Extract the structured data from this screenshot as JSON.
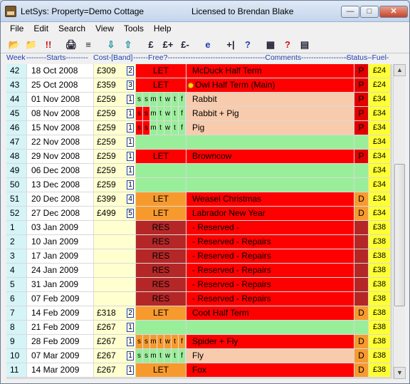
{
  "window": {
    "title": "LetSys: Property=Demo Cottage",
    "license": "Licensed to Brendan Blake",
    "minimize": "—",
    "maximize": "□",
    "close": "✕"
  },
  "menu": [
    "File",
    "Edit",
    "Search",
    "View",
    "Tools",
    "Help"
  ],
  "toolbar": [
    {
      "icon": "folder-open-icon",
      "glyph": "📂"
    },
    {
      "icon": "folder-icon",
      "glyph": "📁"
    },
    {
      "icon": "alert-icon",
      "glyph": "!!"
    },
    {
      "icon": "print-icon",
      "glyph": "🖨"
    },
    {
      "icon": "print-preview-icon",
      "glyph": "≡"
    },
    {
      "icon": "arrow-down-icon",
      "glyph": "⇩"
    },
    {
      "icon": "arrow-up-icon",
      "glyph": "⇧"
    },
    {
      "icon": "pound-icon",
      "glyph": "£"
    },
    {
      "icon": "pound-plus-icon",
      "glyph": "£+"
    },
    {
      "icon": "pound-minus-icon",
      "glyph": "£-"
    },
    {
      "icon": "internet-explorer-icon",
      "glyph": "e"
    },
    {
      "icon": "split-icon",
      "glyph": "+|"
    },
    {
      "icon": "help-icon",
      "glyph": "?"
    },
    {
      "icon": "calculator-icon",
      "glyph": "▦"
    },
    {
      "icon": "help-red-icon",
      "glyph": "?"
    },
    {
      "icon": "notes-icon",
      "glyph": "▤"
    }
  ],
  "header": {
    "week": "Week",
    "starts": "--------Starts---------",
    "cost": "Cost-[Band]",
    "free": "------Free?-------",
    "comments": "---------------------------------Comments---------------------------------",
    "status": "-Status-",
    "fuel": "-Fuel-"
  },
  "colors": {
    "let_red": "#ff0000",
    "let_orange": "#f79a2e",
    "res": "#b52727",
    "comment_red": "#ff0000",
    "comment_salmon": "#f8cbad",
    "free_green": "#99ee99",
    "fuel_yellow": "#ffff33",
    "status_red": "#e00000",
    "status_orange": "#f79a2e"
  },
  "rows": [
    {
      "week": "42",
      "start": "18 Oct 2008",
      "cost": "£309",
      "band": "2",
      "free": "LET",
      "free_type": "let_red",
      "comment": "McDuck  Half Term",
      "comment_type": "red",
      "status": "P",
      "fuel": "£24"
    },
    {
      "week": "43",
      "start": "25 Oct 2008",
      "cost": "£359",
      "band": "3",
      "free": "LET",
      "free_type": "let_red",
      "comment": "Owl  Half Term (Main)",
      "comment_type": "red",
      "dot": true,
      "status": "P",
      "fuel": "£24"
    },
    {
      "week": "44",
      "start": "01 Nov 2008",
      "cost": "£259",
      "band": "1",
      "free": "",
      "free_type": "days",
      "days": [
        "s",
        "s",
        "m",
        "t",
        "w",
        "t",
        "f"
      ],
      "days_let": 0,
      "comment": "Rabbit",
      "comment_type": "salmon",
      "status": "P",
      "fuel": "£34"
    },
    {
      "week": "45",
      "start": "08 Nov 2008",
      "cost": "£259",
      "band": "1",
      "free": "",
      "free_type": "days",
      "days": [
        "s",
        "s",
        "m",
        "t",
        "w",
        "t",
        "f"
      ],
      "days_let": 2,
      "comment": "Rabbit + Pig",
      "comment_type": "salmon",
      "status": "P",
      "fuel": "£34"
    },
    {
      "week": "46",
      "start": "15 Nov 2008",
      "cost": "£259",
      "band": "1",
      "free": "",
      "free_type": "days",
      "days": [
        "s",
        "s",
        "m",
        "t",
        "w",
        "t",
        "f"
      ],
      "days_let": 2,
      "comment": "Pig",
      "comment_type": "salmon",
      "status": "P",
      "fuel": "£34"
    },
    {
      "week": "47",
      "start": "22 Nov 2008",
      "cost": "£259",
      "band": "1",
      "free": "",
      "free_type": "free",
      "comment": "",
      "comment_type": "green",
      "status": "",
      "fuel": "£34"
    },
    {
      "week": "48",
      "start": "29 Nov 2008",
      "cost": "£259",
      "band": "1",
      "free": "LET",
      "free_type": "let_red",
      "comment": "Browncow",
      "comment_type": "red",
      "status": "P",
      "fuel": "£34"
    },
    {
      "week": "49",
      "start": "06 Dec 2008",
      "cost": "£259",
      "band": "1",
      "free": "",
      "free_type": "free",
      "comment": "",
      "comment_type": "green",
      "status": "",
      "fuel": "£34"
    },
    {
      "week": "50",
      "start": "13 Dec 2008",
      "cost": "£259",
      "band": "1",
      "free": "",
      "free_type": "free",
      "comment": "",
      "comment_type": "green",
      "status": "",
      "fuel": "£34"
    },
    {
      "week": "51",
      "start": "20 Dec 2008",
      "cost": "£399",
      "band": "4",
      "free": "LET",
      "free_type": "let_orange",
      "comment": "Weasel  Christmas",
      "comment_type": "red",
      "status": "D",
      "fuel": "£34"
    },
    {
      "week": "52",
      "start": "27 Dec 2008",
      "cost": "£499",
      "band": "5",
      "free": "LET",
      "free_type": "let_orange",
      "comment": "Labrador  New Year",
      "comment_type": "red",
      "status": "D",
      "fuel": "£34"
    },
    {
      "week": "1",
      "start": "03 Jan 2009",
      "cost": "",
      "band": "",
      "free": "RES",
      "free_type": "res",
      "comment": "- Reserved -",
      "comment_type": "red",
      "status": "",
      "fuel": "£38"
    },
    {
      "week": "2",
      "start": "10 Jan 2009",
      "cost": "",
      "band": "",
      "free": "RES",
      "free_type": "res",
      "comment": "- Reserved -  Repairs",
      "comment_type": "red",
      "status": "",
      "fuel": "£38"
    },
    {
      "week": "3",
      "start": "17 Jan 2009",
      "cost": "",
      "band": "",
      "free": "RES",
      "free_type": "res",
      "comment": "- Reserved -  Repairs",
      "comment_type": "red",
      "status": "",
      "fuel": "£38"
    },
    {
      "week": "4",
      "start": "24 Jan 2009",
      "cost": "",
      "band": "",
      "free": "RES",
      "free_type": "res",
      "comment": "- Reserved -  Repairs",
      "comment_type": "red",
      "status": "",
      "fuel": "£38"
    },
    {
      "week": "5",
      "start": "31 Jan 2009",
      "cost": "",
      "band": "",
      "free": "RES",
      "free_type": "res",
      "comment": "- Reserved -  Repairs",
      "comment_type": "red",
      "status": "",
      "fuel": "£38"
    },
    {
      "week": "6",
      "start": "07 Feb 2009",
      "cost": "",
      "band": "",
      "free": "RES",
      "free_type": "res",
      "comment": "- Reserved -  Repairs",
      "comment_type": "red",
      "status": "",
      "fuel": "£38"
    },
    {
      "week": "7",
      "start": "14 Feb 2009",
      "cost": "£318",
      "band": "2",
      "free": "LET",
      "free_type": "let_orange",
      "comment": "Coot  Half Term",
      "comment_type": "red",
      "status": "D",
      "fuel": "£38"
    },
    {
      "week": "8",
      "start": "21 Feb 2009",
      "cost": "£267",
      "band": "1",
      "free": "",
      "free_type": "free",
      "comment": "",
      "comment_type": "green",
      "status": "",
      "fuel": "£38"
    },
    {
      "week": "9",
      "start": "28 Feb 2009",
      "cost": "£267",
      "band": "1",
      "free": "",
      "free_type": "days_orange",
      "days": [
        "s",
        "s",
        "m",
        "t",
        "w",
        "t",
        "f"
      ],
      "days_let": 7,
      "comment": "Spider + Fly",
      "comment_type": "red",
      "status": "D",
      "fuel": "£38"
    },
    {
      "week": "10",
      "start": "07 Mar 2009",
      "cost": "£267",
      "band": "1",
      "free": "",
      "free_type": "days",
      "days": [
        "s",
        "s",
        "m",
        "t",
        "w",
        "t",
        "f"
      ],
      "days_let": 0,
      "comment": "Fly",
      "comment_type": "salmon",
      "status": "D",
      "fuel": "£38"
    },
    {
      "week": "11",
      "start": "14 Mar 2009",
      "cost": "£267",
      "band": "1",
      "free": "LET",
      "free_type": "let_orange",
      "comment": "Fox",
      "comment_type": "red",
      "status": "D",
      "fuel": "£38"
    }
  ]
}
